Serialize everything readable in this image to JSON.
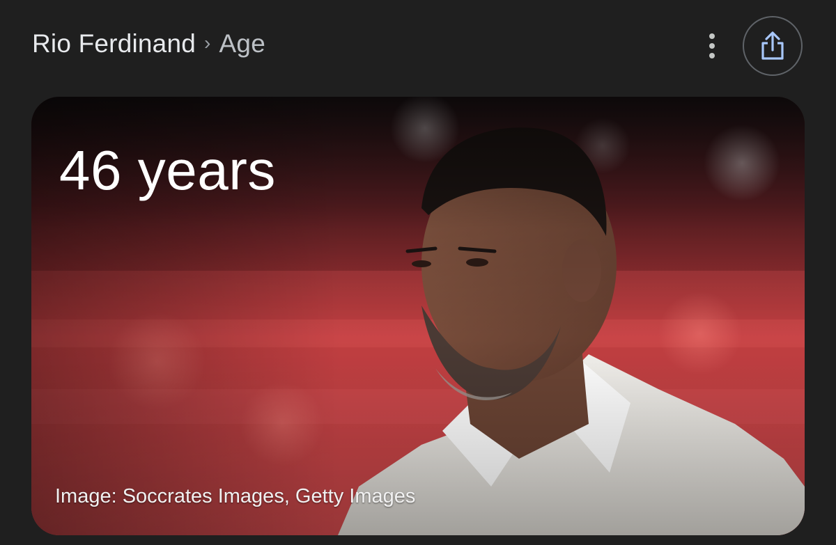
{
  "header": {
    "breadcrumb": {
      "entity": "Rio Ferdinand",
      "separator": "›",
      "attribute": "Age"
    },
    "more_icon": "more-vert-icon",
    "share_icon": "share-icon"
  },
  "card": {
    "age": "46 years",
    "image_credit": "Image: Soccrates Images, Getty Images"
  },
  "colors": {
    "background": "#1f1f1f",
    "text_primary": "#e8eaed",
    "text_secondary": "#bdc1c6",
    "share_icon": "#a8c7fa"
  }
}
